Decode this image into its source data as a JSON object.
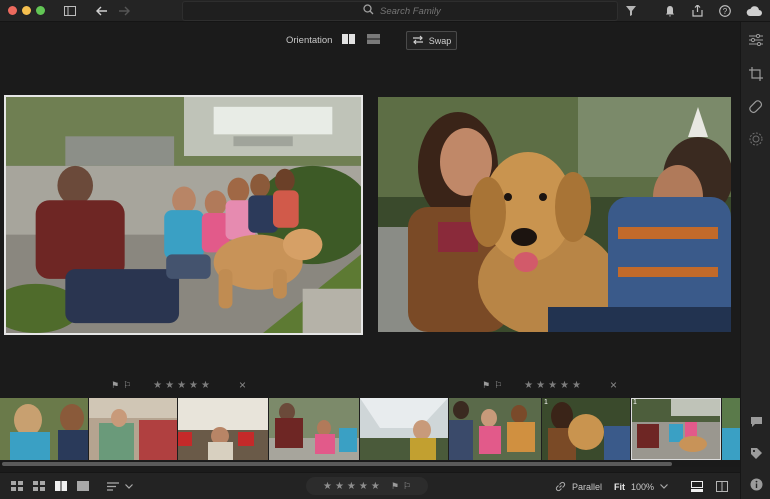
{
  "search": {
    "placeholder": "Search Family"
  },
  "toolbar": {
    "orientation_label": "Orientation",
    "swap_label": "Swap"
  },
  "ratings": {
    "stars": "★★★★★",
    "left_close": "×",
    "right_close": "×"
  },
  "bottombar": {
    "mode_label": "Parallel",
    "fit_label": "Fit",
    "zoom_label": "100%"
  },
  "filmstrip": {
    "badges": [
      "1",
      "1"
    ]
  },
  "icons": {
    "back": "arrow-left-icon",
    "forward": "arrow-right-icon",
    "search": "search-icon",
    "filter": "filter-icon",
    "bell": "bell-icon",
    "share": "share-icon",
    "help": "help-icon",
    "cloud": "cloud-icon"
  },
  "colors": {
    "accent": "#e6e6e6",
    "background": "#1b1b1b"
  }
}
